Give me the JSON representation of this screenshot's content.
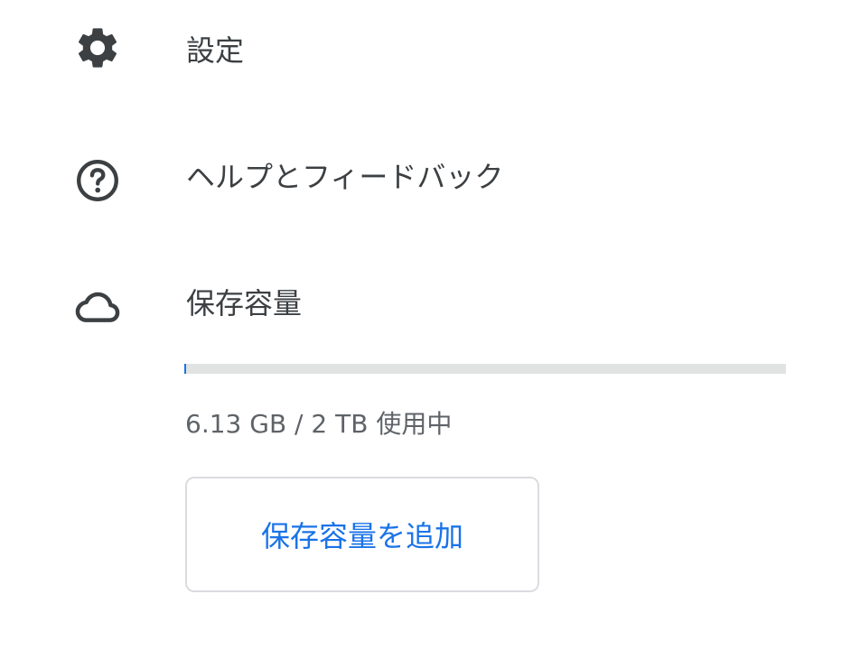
{
  "menu": {
    "items": [
      {
        "label": "設定",
        "icon": "gear-icon"
      },
      {
        "label": "ヘルプとフィードバック",
        "icon": "help-circle-icon"
      },
      {
        "label": "保存容量",
        "icon": "cloud-icon"
      }
    ]
  },
  "storage": {
    "used_fraction": 0.003,
    "usage_text": "6.13 GB / 2 TB 使用中",
    "add_button_label": "保存容量を追加"
  },
  "colors": {
    "text_primary": "#3c4043",
    "text_secondary": "#5f6368",
    "accent": "#1a73e8",
    "bar_track": "#e0e3e1",
    "button_border": "#dadce0"
  }
}
